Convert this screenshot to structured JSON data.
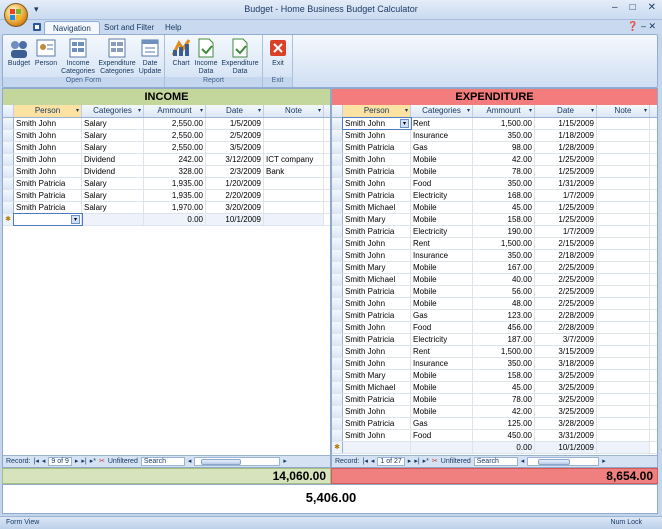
{
  "window": {
    "title": "Budget - Home Business Budget Calculator",
    "controls": [
      "–",
      "□",
      "✕"
    ]
  },
  "tabs": [
    {
      "label": "Navigation",
      "active": true
    },
    {
      "label": "Sort and Filter",
      "active": false
    },
    {
      "label": "Help",
      "active": false
    }
  ],
  "ribbon": {
    "open_form": {
      "label": "Open Form",
      "buttons": [
        {
          "label": "Budget",
          "icon": "budget-icon"
        },
        {
          "label": "Person",
          "icon": "person-icon"
        },
        {
          "label": "Income\nCategories",
          "icon": "income-categories-icon"
        },
        {
          "label": "Expenditure\nCategories",
          "icon": "expenditure-categories-icon"
        },
        {
          "label": "Date\nUpdate",
          "icon": "date-update-icon"
        }
      ]
    },
    "report": {
      "label": "Report",
      "buttons": [
        {
          "label": "Chart",
          "icon": "chart-icon"
        },
        {
          "label": "Income\nData",
          "icon": "income-data-icon"
        },
        {
          "label": "Expenditure\nData",
          "icon": "expenditure-data-icon"
        }
      ]
    },
    "exit": {
      "label": "Exit",
      "buttons": [
        {
          "label": "Exit",
          "icon": "exit-icon"
        }
      ]
    }
  },
  "income": {
    "title": "INCOME",
    "columns": [
      "Person",
      "Categories",
      "Ammount",
      "Date",
      "Note"
    ],
    "rows": [
      [
        "Smith John",
        "Salary",
        "2,550.00",
        "1/5/2009",
        ""
      ],
      [
        "Smith John",
        "Salary",
        "2,550.00",
        "2/5/2009",
        ""
      ],
      [
        "Smith John",
        "Salary",
        "2,550.00",
        "3/5/2009",
        ""
      ],
      [
        "Smith John",
        "Dividend",
        "242.00",
        "3/12/2009",
        "ICT company"
      ],
      [
        "Smith John",
        "Dividend",
        "328.00",
        "2/3/2009",
        "Bank"
      ],
      [
        "Smith Patricia",
        "Salary",
        "1,935.00",
        "1/20/2009",
        ""
      ],
      [
        "Smith Patricia",
        "Salary",
        "1,935.00",
        "2/20/2009",
        ""
      ],
      [
        "Smith Patricia",
        "Salary",
        "1,970.00",
        "3/20/2009",
        ""
      ]
    ],
    "new_row": [
      "",
      "",
      "0.00",
      "10/1/2009",
      ""
    ],
    "nav": {
      "label": "Record:",
      "position": "9 of 9",
      "filter": "Unfiltered",
      "search": "Search"
    },
    "total": "14,060.00"
  },
  "expenditure": {
    "title": "EXPENDITURE",
    "columns": [
      "Person",
      "Categories",
      "Ammount",
      "Date",
      "Note"
    ],
    "rows": [
      [
        "Smith John",
        "Rent",
        "1,500.00",
        "1/15/2009",
        ""
      ],
      [
        "Smith John",
        "Insurance",
        "350.00",
        "1/18/2009",
        ""
      ],
      [
        "Smith Patricia",
        "Gas",
        "98.00",
        "1/28/2009",
        ""
      ],
      [
        "Smith John",
        "Mobile",
        "42.00",
        "1/25/2009",
        ""
      ],
      [
        "Smith Patricia",
        "Mobile",
        "78.00",
        "1/25/2009",
        ""
      ],
      [
        "Smith John",
        "Food",
        "350.00",
        "1/31/2009",
        ""
      ],
      [
        "Smith Patricia",
        "Electricity",
        "168.00",
        "1/7/2009",
        ""
      ],
      [
        "Smith Michael",
        "Mobile",
        "45.00",
        "1/25/2009",
        ""
      ],
      [
        "Smith Mary",
        "Mobile",
        "158.00",
        "1/25/2009",
        ""
      ],
      [
        "Smith Patricia",
        "Electricity",
        "190.00",
        "1/7/2009",
        ""
      ],
      [
        "Smith John",
        "Rent",
        "1,500.00",
        "2/15/2009",
        ""
      ],
      [
        "Smith John",
        "Insurance",
        "350.00",
        "2/18/2009",
        ""
      ],
      [
        "Smith Mary",
        "Mobile",
        "167.00",
        "2/25/2009",
        ""
      ],
      [
        "Smith Michael",
        "Mobile",
        "40.00",
        "2/25/2009",
        ""
      ],
      [
        "Smith Patricia",
        "Mobile",
        "56.00",
        "2/25/2009",
        ""
      ],
      [
        "Smith John",
        "Mobile",
        "48.00",
        "2/25/2009",
        ""
      ],
      [
        "Smith Patricia",
        "Gas",
        "123.00",
        "2/28/2009",
        ""
      ],
      [
        "Smith John",
        "Food",
        "456.00",
        "2/28/2009",
        ""
      ],
      [
        "Smith Patricia",
        "Electricity",
        "187.00",
        "3/7/2009",
        ""
      ],
      [
        "Smith John",
        "Rent",
        "1,500.00",
        "3/15/2009",
        ""
      ],
      [
        "Smith John",
        "Insurance",
        "350.00",
        "3/18/2009",
        ""
      ],
      [
        "Smith Mary",
        "Mobile",
        "158.00",
        "3/25/2009",
        ""
      ],
      [
        "Smith Michael",
        "Mobile",
        "45.00",
        "3/25/2009",
        ""
      ],
      [
        "Smith Patricia",
        "Mobile",
        "78.00",
        "3/25/2009",
        ""
      ],
      [
        "Smith John",
        "Mobile",
        "42.00",
        "3/25/2009",
        ""
      ],
      [
        "Smith Patricia",
        "Gas",
        "125.00",
        "3/28/2009",
        ""
      ],
      [
        "Smith John",
        "Food",
        "450.00",
        "3/31/2009",
        ""
      ]
    ],
    "new_row": [
      "",
      "",
      "0.00",
      "10/1/2009",
      ""
    ],
    "nav": {
      "label": "Record:",
      "position": "1 of 27",
      "filter": "Unfiltered",
      "search": "Search"
    },
    "total": "8,654.00"
  },
  "balance": "5,406.00",
  "status": {
    "left": "Form View",
    "right": "Num Lock"
  },
  "colors": {
    "income_header": "#c3d69b",
    "expenditure_header": "#f47c7c"
  }
}
